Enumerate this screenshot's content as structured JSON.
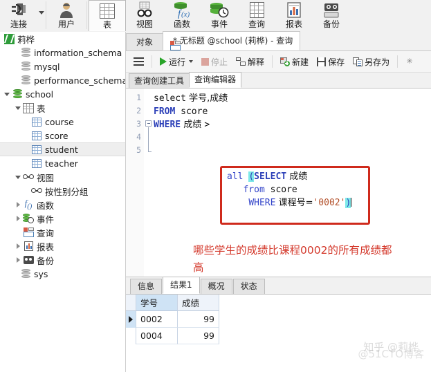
{
  "ribbon": {
    "items": [
      {
        "label": "连接",
        "icon": "plug-icon",
        "has_caret": true,
        "selected": false
      },
      {
        "label": "用户",
        "icon": "user-icon",
        "has_caret": false,
        "selected": false
      },
      {
        "label": "表",
        "icon": "table-icon",
        "has_caret": false,
        "selected": true
      },
      {
        "label": "视图",
        "icon": "view-glasses-icon",
        "has_caret": false,
        "selected": false
      },
      {
        "label": "函数",
        "icon": "fx-icon",
        "has_caret": false,
        "selected": false
      },
      {
        "label": "事件",
        "icon": "event-clock-icon",
        "has_caret": false,
        "selected": false
      },
      {
        "label": "查询",
        "icon": "query-icon",
        "has_caret": false,
        "selected": false
      },
      {
        "label": "报表",
        "icon": "report-chart-icon",
        "has_caret": false,
        "selected": false
      },
      {
        "label": "备份",
        "icon": "backup-icon",
        "has_caret": false,
        "selected": false
      }
    ]
  },
  "sidebar": {
    "root": {
      "label": "莉桦",
      "icon": "app-logo-icon"
    },
    "items": [
      {
        "label": "information_schema",
        "icon": "database-icon",
        "indent": 1,
        "arrow": "none",
        "selected": false
      },
      {
        "label": "mysql",
        "icon": "database-icon",
        "indent": 1,
        "arrow": "none",
        "selected": false
      },
      {
        "label": "performance_schema",
        "icon": "database-icon",
        "indent": 1,
        "arrow": "none",
        "selected": false
      },
      {
        "label": "school",
        "icon": "database-open-icon",
        "indent": 1,
        "arrow": "open",
        "selected": false
      },
      {
        "label": "表",
        "icon": "table-folder-icon",
        "indent": 2,
        "arrow": "open",
        "selected": false
      },
      {
        "label": "course",
        "icon": "table-icon",
        "indent": 3,
        "arrow": "none",
        "selected": false
      },
      {
        "label": "score",
        "icon": "table-icon",
        "indent": 3,
        "arrow": "none",
        "selected": false
      },
      {
        "label": "student",
        "icon": "table-icon",
        "indent": 3,
        "arrow": "none",
        "selected": true
      },
      {
        "label": "teacher",
        "icon": "table-icon",
        "indent": 3,
        "arrow": "none",
        "selected": false
      },
      {
        "label": "视图",
        "icon": "view-glasses-icon",
        "indent": 2,
        "arrow": "open",
        "selected": false
      },
      {
        "label": "按性别分组",
        "icon": "view-glasses-icon",
        "indent": 3,
        "arrow": "none",
        "selected": false
      },
      {
        "label": "函数",
        "icon": "fx-icon",
        "indent": 2,
        "arrow": "closed",
        "selected": false
      },
      {
        "label": "事件",
        "icon": "event-clock-icon",
        "indent": 2,
        "arrow": "closed",
        "selected": false
      },
      {
        "label": "查询",
        "icon": "query-icon",
        "indent": 2,
        "arrow": "none",
        "selected": false
      },
      {
        "label": "报表",
        "icon": "report-chart-icon",
        "indent": 2,
        "arrow": "closed",
        "selected": false
      },
      {
        "label": "备份",
        "icon": "backup-icon",
        "indent": 2,
        "arrow": "closed",
        "selected": false
      },
      {
        "label": "sys",
        "icon": "database-icon",
        "indent": 1,
        "arrow": "none",
        "selected": false
      }
    ]
  },
  "pane": {
    "object_tab": "对象",
    "query_tab": "* 无标题 @school (莉桦) - 查询",
    "toolbar": {
      "menu": "menu-hamburger",
      "run": "运行",
      "stop": "停止",
      "explain": "解释",
      "new": "新建",
      "save": "保存",
      "save_as": "另存为"
    },
    "subtabs": [
      {
        "label": "查询创建工具",
        "active": false
      },
      {
        "label": "查询编辑器",
        "active": true
      }
    ]
  },
  "editor": {
    "line_numbers": [
      "1",
      "2",
      "3",
      "4",
      "5"
    ],
    "main": {
      "l1_kw": "select",
      "l1_cols": " 学号,成绩",
      "l2_kw": "FROM",
      "l2_tbl": " score",
      "l3_kw": "WHERE",
      "l3_col": " 成绩 ",
      "l3_op": ">"
    },
    "sub": {
      "l1_all": "all ",
      "l1_paren": "(",
      "l1_kw": "SELECT",
      "l1_col": " 成绩",
      "l2_kw": "from",
      "l2_tbl": " score",
      "l3_kw": "WHERE",
      "l3_col": " 课程号=",
      "l3_str": "'0002'",
      "l3_paren": ")"
    },
    "annotation": "哪些学生的成绩比课程0002的所有成绩都高"
  },
  "results": {
    "tabs": [
      {
        "label": "信息",
        "active": false
      },
      {
        "label": "结果1",
        "active": true
      },
      {
        "label": "概况",
        "active": false
      },
      {
        "label": "状态",
        "active": false
      }
    ],
    "columns": [
      "学号",
      "成绩"
    ],
    "rows": [
      {
        "current": true,
        "cells": [
          "0002",
          "99"
        ]
      },
      {
        "current": false,
        "cells": [
          "0004",
          "99"
        ]
      }
    ]
  },
  "watermark": {
    "line1": "知乎 @莉桦",
    "line2": "@51CTO博客"
  },
  "colors": {
    "accent_red": "#cf2a1c",
    "annotation_red": "#d43a2d",
    "keyword_blue": "#2b3fb8",
    "string_orange": "#b3502a",
    "db_green": "#62bb46",
    "run_green": "#28a428",
    "selected_col": "#cfe3f5"
  }
}
